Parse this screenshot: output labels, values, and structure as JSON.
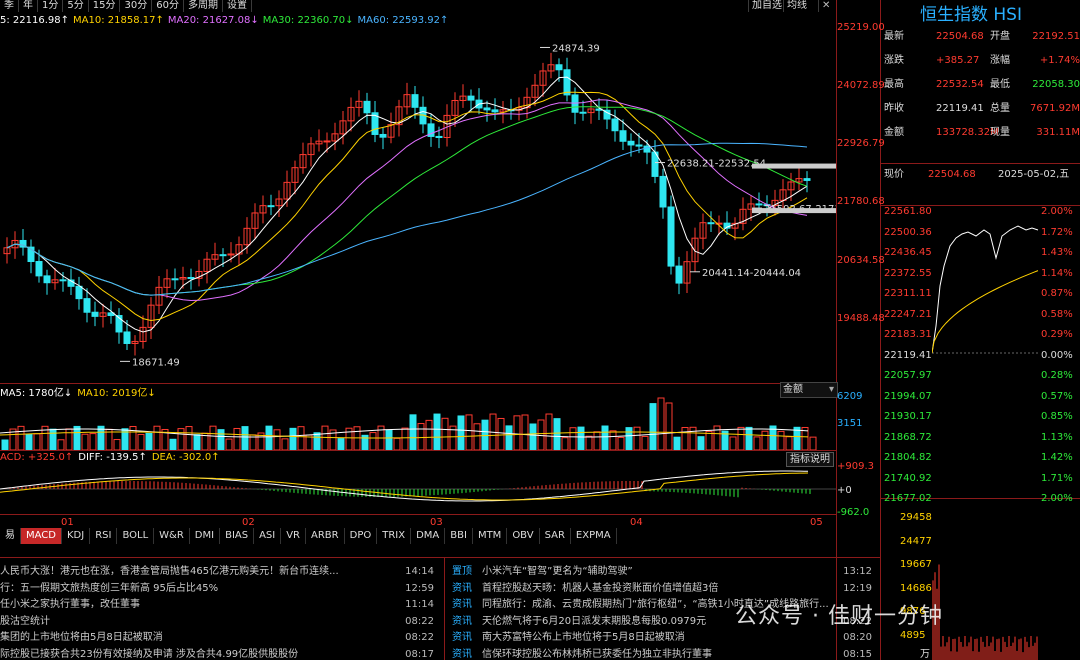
{
  "toolbar": {
    "items": [
      "季",
      "年",
      "1分",
      "5分",
      "15分",
      "30分",
      "60分",
      "多周期",
      "设置"
    ],
    "right_items": [
      "加自选",
      "均线"
    ],
    "close": "✕"
  },
  "ma_legend": [
    {
      "text": "5: 22116.98↑",
      "color": "#ffffff"
    },
    {
      "text": "MA10: 21858.17↑",
      "color": "#ffd200"
    },
    {
      "text": "MA20: 21627.08↓",
      "color": "#e070ff"
    },
    {
      "text": "MA30: 22360.70↓",
      "color": "#2eea3a"
    },
    {
      "text": "MA60: 22593.92↑",
      "color": "#4ab4ff"
    }
  ],
  "price_axis": [
    "25219.00",
    "24072.89",
    "22926.79",
    "21780.68",
    "20634.58",
    "19488.48"
  ],
  "annotations": {
    "high": "24874.39",
    "low": "18671.49",
    "a1": "22638.21-22532.54",
    "a2": "21592.67-21712.",
    "a3": "20441.14-20444.04"
  },
  "volume": {
    "legend": [
      {
        "text": "MA5: 1780亿↓",
        "color": "#ffffff"
      },
      {
        "text": "MA10: 2019亿↓",
        "color": "#ffd200"
      }
    ],
    "axis": [
      "6209",
      "3151"
    ],
    "dropdown": "金额"
  },
  "macd": {
    "legend": [
      {
        "text": "ACD: +325.0↑",
        "color": "#ff3b30"
      },
      {
        "text": "DIFF: -139.5↑",
        "color": "#ffffff"
      },
      {
        "text": "DEA: -302.0↑",
        "color": "#ffd200"
      }
    ],
    "axis": [
      "+909.3",
      "+0",
      "-962.0"
    ],
    "button": "指标说明"
  },
  "dates": [
    "01",
    "02",
    "03",
    "04",
    "05"
  ],
  "tabs": [
    "易",
    "MACD",
    "KDJ",
    "RSI",
    "BOLL",
    "W&R",
    "DMI",
    "BIAS",
    "ASI",
    "VR",
    "ARBR",
    "DPO",
    "TRIX",
    "DMA",
    "BBI",
    "MTM",
    "OBV",
    "SAR",
    "EXPMA"
  ],
  "news_left": [
    {
      "title": "人民币大涨！港元也在涨，香港金管局抛售465亿港元购美元！新台币连续...",
      "time": "14:14"
    },
    {
      "title": "行：五一假期文旅热度创三年新高 95后占比45%",
      "time": "12:59"
    },
    {
      "title": "任小米之家执行董事，改任董事",
      "time": "11:14"
    },
    {
      "title": "股沽空统计",
      "time": "08:22"
    },
    {
      "title": "集团的上市地位将由5月8日起被取消",
      "time": "08:22"
    },
    {
      "title": "际控股已接获合共23份有效接纳及申请 涉及合共4.99亿股供股股份",
      "time": "08:17"
    }
  ],
  "news_right": [
    {
      "tag": "置顶",
      "title": "小米汽车“智驾”更名为“辅助驾驶”",
      "time": "13:12"
    },
    {
      "tag": "资讯",
      "title": "首程控股赵天旸：机器人基金投资账面价值增值超3倍",
      "time": "12:19"
    },
    {
      "tag": "资讯",
      "title": "同程旅行：成渝、云贵成假期热门“旅行枢纽”，“高铁1小时直达”成线路旅行...",
      "time": ""
    },
    {
      "tag": "资讯",
      "title": "天伦燃气将于6月20日派发末期股息每股0.0979元",
      "time": "08:22"
    },
    {
      "tag": "资讯",
      "title": "南大苏富特公布上市地位将于5月8日起被取消",
      "time": "08:20"
    },
    {
      "tag": "资讯",
      "title": "信保环球控股公布林炜桥已获委任为独立非执行董事",
      "time": "08:15"
    }
  ],
  "quote": {
    "title": "恒生指数 HSI",
    "rows": [
      {
        "l1": "最新",
        "v1": "22504.68",
        "c1": "red",
        "l2": "开盘",
        "v2": "22192.51",
        "c2": "red"
      },
      {
        "l1": "涨跌",
        "v1": "+385.27",
        "c1": "red",
        "l2": "涨幅",
        "v2": "+1.74%",
        "c2": "red"
      },
      {
        "l1": "最高",
        "v1": "22532.54",
        "c1": "red",
        "l2": "最低",
        "v2": "22058.30",
        "c2": "green"
      },
      {
        "l1": "昨收",
        "v1": "22119.41",
        "c1": "white",
        "l2": "总量",
        "v2": "7671.92M",
        "c2": "red"
      },
      {
        "l1": "金额",
        "v1": "133728.32M",
        "c1": "red",
        "l2": "现量",
        "v2": "331.11M",
        "c2": "red"
      }
    ],
    "now_label": "现价",
    "now_value": "22504.68",
    "now_date": "2025-05-02,五"
  },
  "mini": {
    "prices": [
      "22561.80",
      "22500.36",
      "22436.45",
      "22372.55",
      "22311.11",
      "22247.21",
      "22183.31",
      "22119.41",
      "22057.97",
      "21994.07",
      "21930.17",
      "21868.72",
      "21804.82",
      "21740.92",
      "21677.02"
    ],
    "pcts": [
      "2.00%",
      "1.72%",
      "1.43%",
      "1.14%",
      "0.87%",
      "0.58%",
      "0.29%",
      "0.00%",
      "0.28%",
      "0.57%",
      "0.85%",
      "1.13%",
      "1.42%",
      "1.71%",
      "2.00%"
    ],
    "vol": [
      "29458",
      "24477",
      "19667",
      "14686",
      "9876",
      "4895"
    ],
    "vol_unit": "万"
  },
  "watermark": "公众号 · 佳财一分钟"
}
